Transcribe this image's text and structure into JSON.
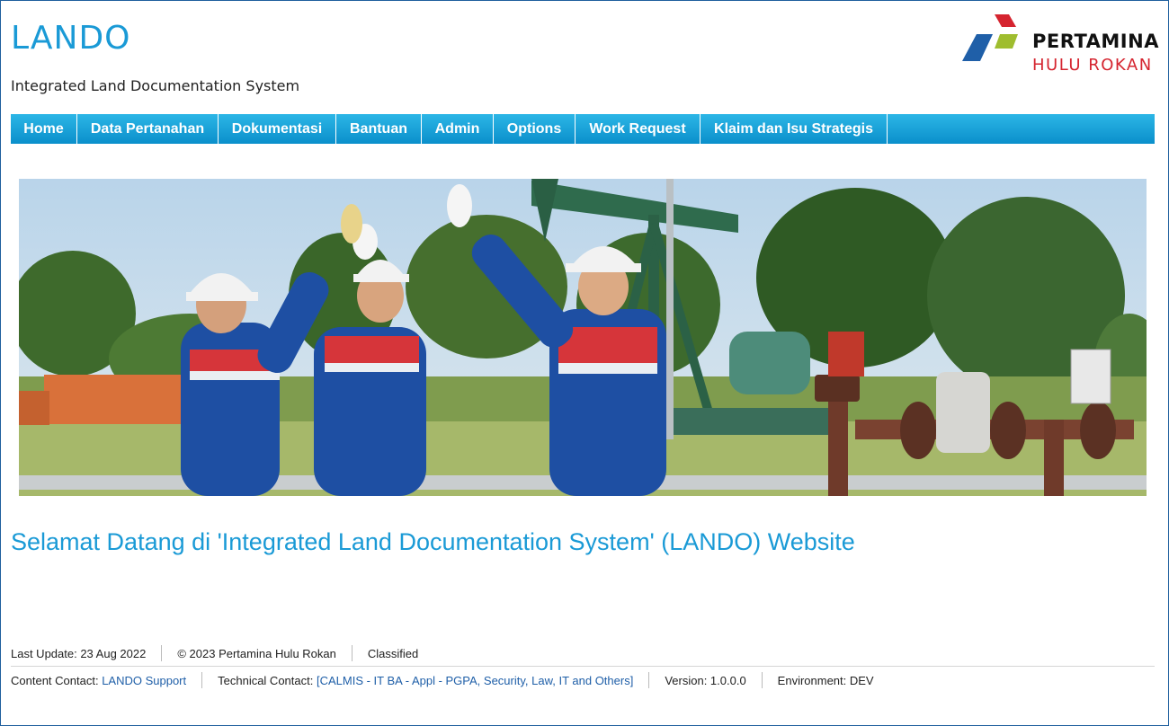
{
  "header": {
    "title": "LANDO",
    "subtitle": "Integrated Land Documentation System"
  },
  "logo": {
    "line1": "PERTAMINA",
    "line2": "HULU ROKAN",
    "colors": {
      "red": "#d5242f",
      "green": "#9fbd2f",
      "blue": "#1f5fa8"
    }
  },
  "nav": {
    "items": [
      {
        "label": "Home"
      },
      {
        "label": "Data Pertanahan"
      },
      {
        "label": "Dokumentasi"
      },
      {
        "label": "Bantuan"
      },
      {
        "label": "Admin"
      },
      {
        "label": "Options"
      },
      {
        "label": "Work Request"
      },
      {
        "label": "Klaim dan Isu Strategis"
      }
    ]
  },
  "main": {
    "welcome": "Selamat Datang di 'Integrated Land Documentation System' (LANDO) Website"
  },
  "footer": {
    "last_update": "Last Update: 23 Aug 2022",
    "copyright": "© 2023 Pertamina Hulu Rokan",
    "classification": "Classified",
    "content_contact_label": "Content Contact:",
    "content_contact_link": "LANDO Support",
    "technical_contact_label": "Technical Contact:",
    "technical_contact_link": "[CALMIS - IT BA - Appl - PGPA, Security, Law, IT and Others]",
    "version": "Version: 1.0.0.0",
    "environment": "Environment: DEV"
  },
  "theme": {
    "accent": "#1a9ad6",
    "nav_top": "#2cb6e6",
    "nav_bottom": "#0a8fcb",
    "link": "#1f5fa8"
  }
}
